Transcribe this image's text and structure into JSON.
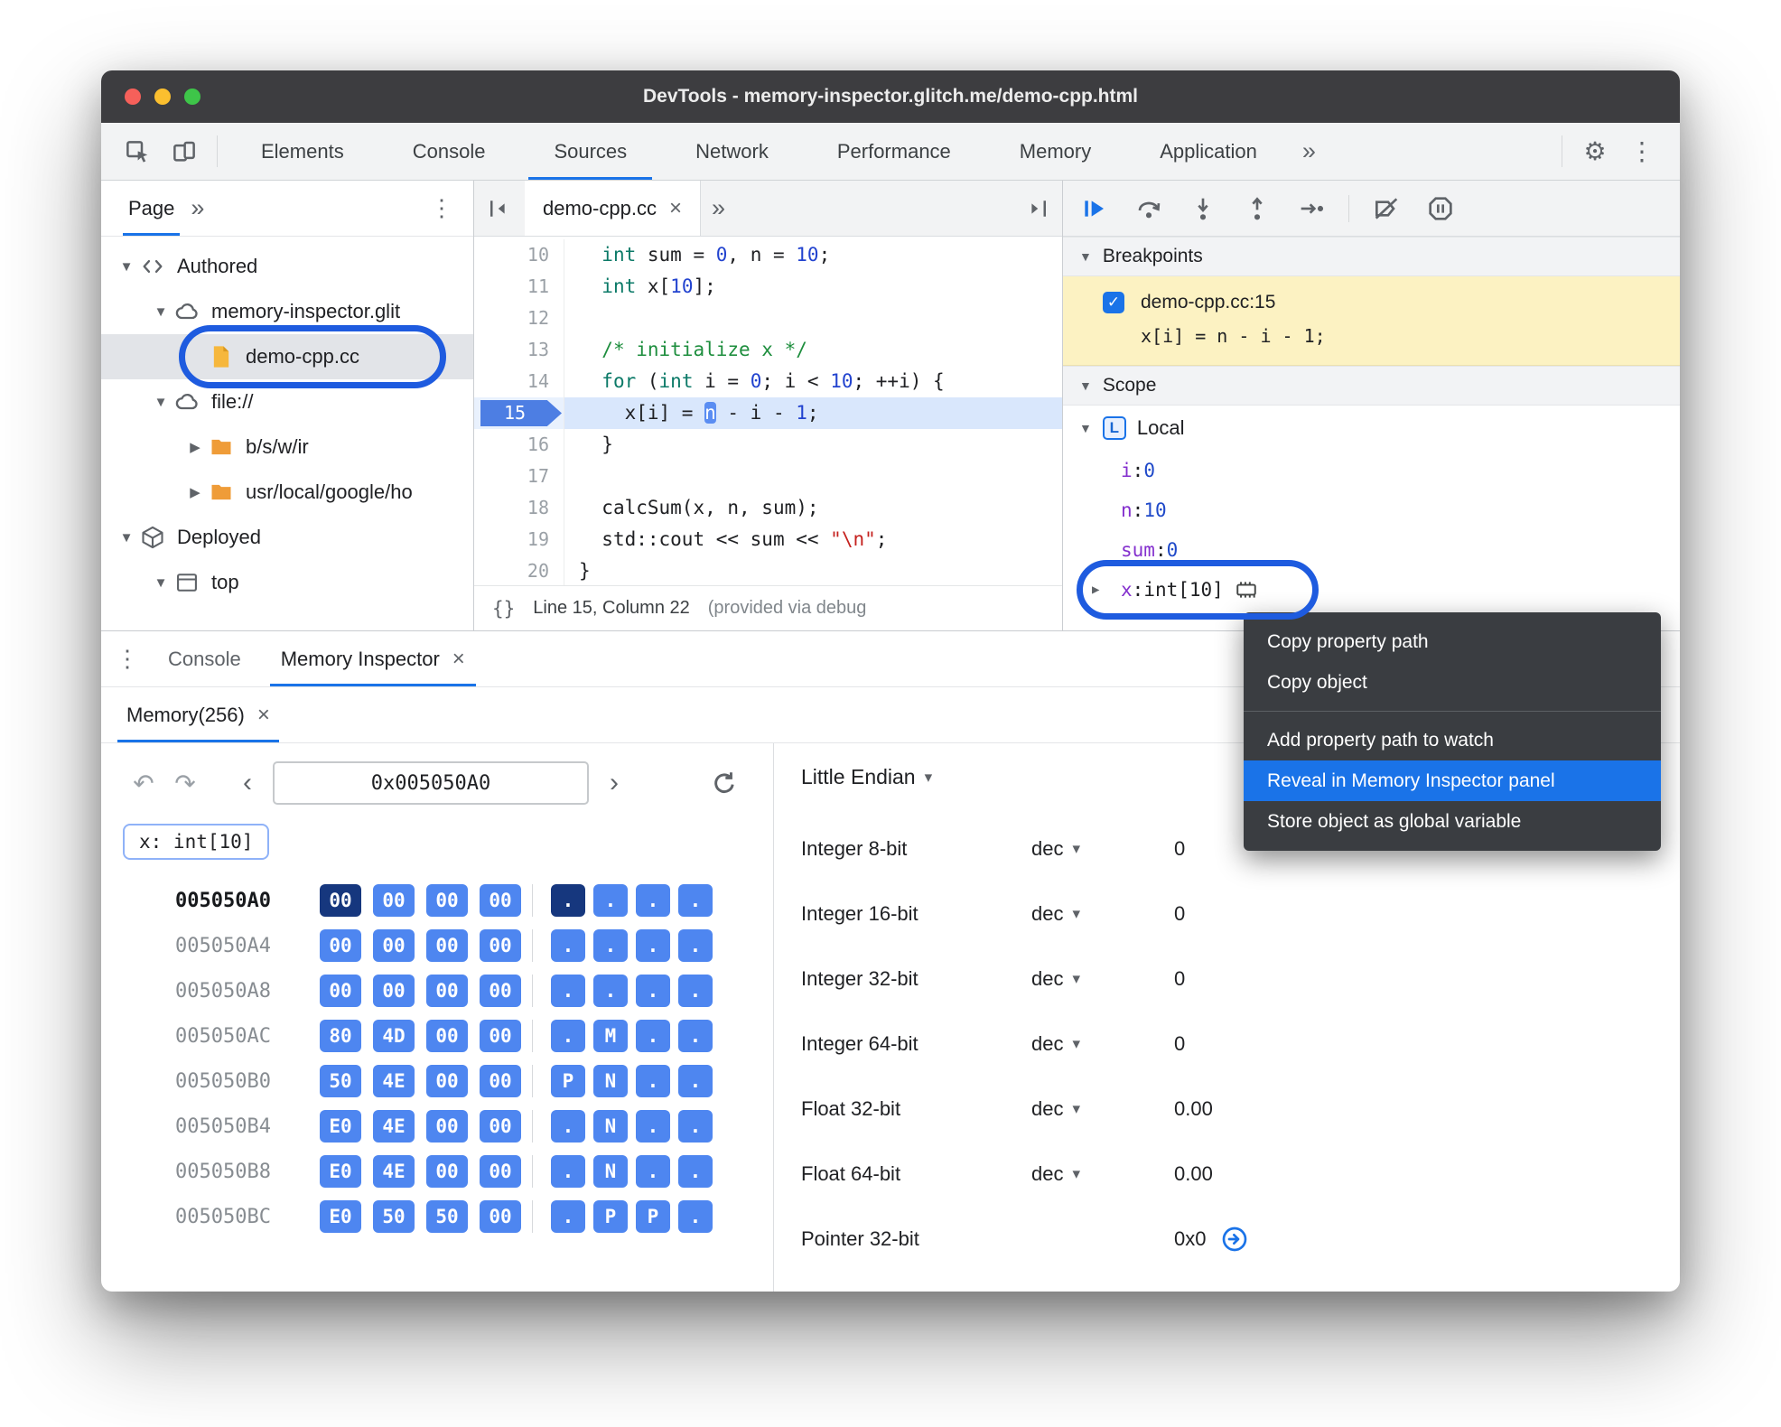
{
  "window": {
    "title": "DevTools - memory-inspector.glitch.me/demo-cpp.html"
  },
  "icons": {
    "gear": "⚙",
    "kebab": "⋮",
    "overflow": "»",
    "chevron_down": "▾",
    "undo": "↶",
    "redo": "↷",
    "prev": "‹",
    "next": "›",
    "close": "×",
    "expanded": "▼",
    "collapsed": "▶",
    "check": "✓",
    "braces": "{}"
  },
  "colors": {
    "accent": "#1a73e8",
    "byte_chip": "#4e86f0",
    "byte_selected": "#16377e",
    "breakpoint_bg": "#fcf2c2",
    "menu_bg": "#3a3d41",
    "annotation": "#1e5bdf",
    "keyword": "#0c7a68",
    "number": "#2243cf",
    "comment": "#1e8e3e",
    "string": "#c5221f"
  },
  "main_toolbar": {
    "tabs": [
      {
        "label": "Elements"
      },
      {
        "label": "Console"
      },
      {
        "label": "Sources",
        "active": true
      },
      {
        "label": "Network"
      },
      {
        "label": "Performance"
      },
      {
        "label": "Memory"
      },
      {
        "label": "Application"
      }
    ]
  },
  "navigator": {
    "tab_label": "Page",
    "tree": [
      {
        "label": "Authored",
        "icon": "code",
        "level": 0,
        "arrow": "expanded"
      },
      {
        "label": "memory-inspector.glit",
        "icon": "cloud",
        "level": 1,
        "arrow": "expanded"
      },
      {
        "label": "demo-cpp.cc",
        "icon": "file",
        "level": 2,
        "arrow": "none",
        "selected": true
      },
      {
        "label": "file://",
        "icon": "cloud",
        "level": 1,
        "arrow": "expanded"
      },
      {
        "label": "b/s/w/ir",
        "icon": "folder",
        "level": 2,
        "arrow": "collapsed"
      },
      {
        "label": "usr/local/google/ho",
        "icon": "folder",
        "level": 2,
        "arrow": "collapsed"
      },
      {
        "label": "Deployed",
        "icon": "package",
        "level": 0,
        "arrow": "expanded"
      },
      {
        "label": "top",
        "icon": "frame",
        "level": 1,
        "arrow": "expanded"
      }
    ]
  },
  "editor": {
    "tab": {
      "label": "demo-cpp.cc",
      "close": "×"
    },
    "lines": [
      {
        "num": 10,
        "tokens": [
          [
            "  ",
            ""
          ],
          [
            "int",
            "kw"
          ],
          [
            " sum = ",
            ""
          ],
          [
            "0",
            "num"
          ],
          [
            ", n = ",
            ""
          ],
          [
            "10",
            "num"
          ],
          [
            ";",
            ""
          ]
        ]
      },
      {
        "num": 11,
        "tokens": [
          [
            "  ",
            ""
          ],
          [
            "int",
            "kw"
          ],
          [
            " x[",
            ""
          ],
          [
            "10",
            "num"
          ],
          [
            "];",
            ""
          ]
        ]
      },
      {
        "num": 12,
        "tokens": []
      },
      {
        "num": 13,
        "tokens": [
          [
            "  ",
            ""
          ],
          [
            "/* initialize x */",
            "cmt"
          ]
        ]
      },
      {
        "num": 14,
        "tokens": [
          [
            "  ",
            ""
          ],
          [
            "for",
            "kw"
          ],
          [
            " (",
            ""
          ],
          [
            "int",
            "kw"
          ],
          [
            " i = ",
            ""
          ],
          [
            "0",
            "num"
          ],
          [
            "; i < ",
            ""
          ],
          [
            "10",
            "num"
          ],
          [
            "; ++i) {",
            ""
          ]
        ]
      },
      {
        "num": 15,
        "current": true,
        "breakpoint": true,
        "tokens": [
          [
            "    ",
            ""
          ],
          [
            "x[i] = ",
            ""
          ],
          [
            "n",
            "hl"
          ],
          [
            " - i - ",
            ""
          ],
          [
            "1",
            "num"
          ],
          [
            ";",
            ""
          ]
        ]
      },
      {
        "num": 16,
        "tokens": [
          [
            "  ",
            ""
          ],
          [
            "}",
            ""
          ]
        ]
      },
      {
        "num": 17,
        "tokens": []
      },
      {
        "num": 18,
        "tokens": [
          [
            "  ",
            ""
          ],
          [
            "calcSum(x, n, sum);",
            ""
          ]
        ]
      },
      {
        "num": 19,
        "tokens": [
          [
            "  ",
            ""
          ],
          [
            "std::cout << sum << ",
            ""
          ],
          [
            "\"\\n\"",
            "str"
          ],
          [
            ";",
            ""
          ]
        ]
      },
      {
        "num": 20,
        "tokens": [
          [
            "}",
            ""
          ]
        ]
      }
    ],
    "status": {
      "pretty": "{}",
      "position": "Line 15, Column 22",
      "note": "(provided via debug"
    }
  },
  "debugger": {
    "sections": {
      "breakpoints": "Breakpoints",
      "scope": "Scope"
    },
    "breakpoint": {
      "checked": true,
      "title": "demo-cpp.cc:15",
      "code": "x[i] = n - i - 1;"
    },
    "scope_group": {
      "badge": "L",
      "label": "Local"
    },
    "variables": [
      {
        "name": "i",
        "value": "0",
        "value_type": "num"
      },
      {
        "name": "n",
        "value": "10",
        "value_type": "num"
      },
      {
        "name": "sum",
        "value": "0",
        "value_type": "num"
      },
      {
        "name": "x",
        "value": "int[10]",
        "value_type": "obj",
        "expandable": true,
        "memory_icon": true
      }
    ]
  },
  "context_menu": {
    "items": [
      {
        "label": "Copy property path"
      },
      {
        "label": "Copy object"
      },
      {
        "separator": true
      },
      {
        "label": "Add property path to watch"
      },
      {
        "label": "Reveal in Memory Inspector panel",
        "highlighted": true
      },
      {
        "label": "Store object as global variable"
      }
    ]
  },
  "drawer": {
    "tabs": [
      {
        "label": "Console"
      },
      {
        "label": "Memory Inspector",
        "close": "×",
        "active": true
      }
    ]
  },
  "memory_inspector": {
    "tab": {
      "label": "Memory(256)",
      "close": "×"
    },
    "address_input": "0x005050A0",
    "tag": "x: int[10]",
    "endianness": "Little Endian",
    "rows": [
      {
        "address": "005050A0",
        "bytes": [
          "00",
          "00",
          "00",
          "00"
        ],
        "ascii": [
          ".",
          ".",
          ".",
          "."
        ],
        "selected_byte": 0
      },
      {
        "address": "005050A4",
        "bytes": [
          "00",
          "00",
          "00",
          "00"
        ],
        "ascii": [
          ".",
          ".",
          ".",
          "."
        ]
      },
      {
        "address": "005050A8",
        "bytes": [
          "00",
          "00",
          "00",
          "00"
        ],
        "ascii": [
          ".",
          ".",
          ".",
          "."
        ]
      },
      {
        "address": "005050AC",
        "bytes": [
          "80",
          "4D",
          "00",
          "00"
        ],
        "ascii": [
          ".",
          "M",
          ".",
          "."
        ]
      },
      {
        "address": "005050B0",
        "bytes": [
          "50",
          "4E",
          "00",
          "00"
        ],
        "ascii": [
          "P",
          "N",
          ".",
          "."
        ]
      },
      {
        "address": "005050B4",
        "bytes": [
          "E0",
          "4E",
          "00",
          "00"
        ],
        "ascii": [
          ".",
          "N",
          ".",
          "."
        ]
      },
      {
        "address": "005050B8",
        "bytes": [
          "E0",
          "4E",
          "00",
          "00"
        ],
        "ascii": [
          ".",
          "N",
          ".",
          "."
        ]
      },
      {
        "address": "005050BC",
        "bytes": [
          "E0",
          "50",
          "50",
          "00"
        ],
        "ascii": [
          ".",
          "P",
          "P",
          "."
        ]
      }
    ],
    "value_rows": [
      {
        "label": "Integer 8-bit",
        "format": "dec",
        "value": "0"
      },
      {
        "label": "Integer 16-bit",
        "format": "dec",
        "value": "0"
      },
      {
        "label": "Integer 32-bit",
        "format": "dec",
        "value": "0"
      },
      {
        "label": "Integer 64-bit",
        "format": "dec",
        "value": "0"
      },
      {
        "label": "Float 32-bit",
        "format": "dec",
        "value": "0.00"
      },
      {
        "label": "Float 64-bit",
        "format": "dec",
        "value": "0.00"
      },
      {
        "label": "Pointer 32-bit",
        "format": "",
        "value": "0x0",
        "jump": true
      }
    ]
  }
}
